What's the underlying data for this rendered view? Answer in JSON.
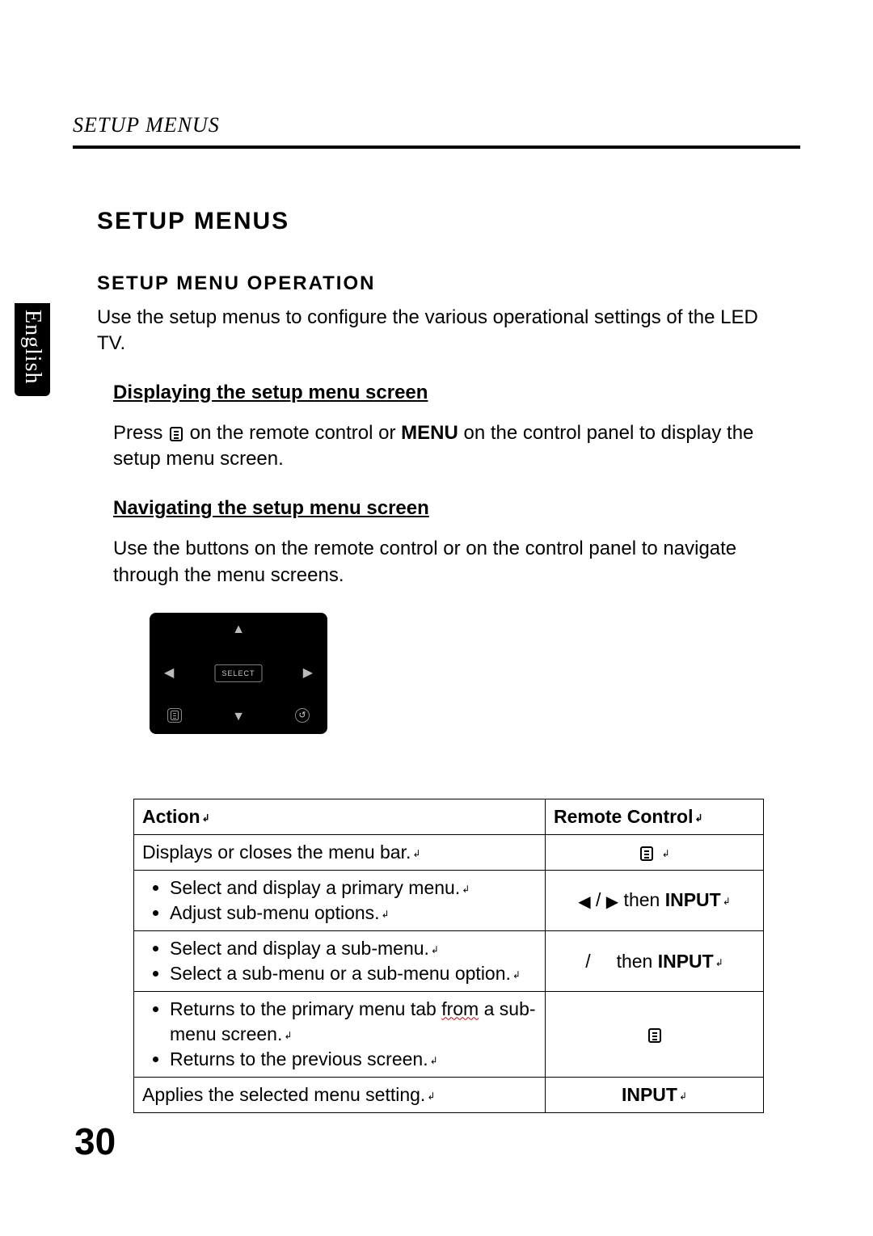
{
  "header": {
    "running": "SETUP MENUS"
  },
  "langTab": "English",
  "h1": "SETUP MENUS",
  "h2": "SETUP MENU OPERATION",
  "intro": "Use the setup menus to configure the various operational settings of the LED TV.",
  "sec1": {
    "head": "Displaying the setup menu screen",
    "p_a": "Press ",
    "p_b": " on the remote control or ",
    "menu_word": "MENU",
    "p_c": " on the control panel to display the setup menu screen."
  },
  "sec2": {
    "head": "Navigating the setup menu screen",
    "p": "Use the buttons on the remote control or on the control panel to navigate through the menu screens."
  },
  "remote": {
    "select": "SELECT",
    "back": "↺"
  },
  "table": {
    "h_action": "Action",
    "h_remote": "Remote Control",
    "r1": {
      "action": "Displays or closes the menu bar."
    },
    "r2": {
      "a": "Select and display a primary menu.",
      "b": "Adjust sub-menu options.",
      "rc_then": " then ",
      "rc_input": "INPUT"
    },
    "r3": {
      "a": "Select and display a sub-menu.",
      "b": "Select a sub-menu or a sub-menu option.",
      "rc_slash": "/",
      "rc_then": "then ",
      "rc_input": "INPUT"
    },
    "r4": {
      "a_pre": "Returns to the primary menu tab ",
      "a_wavy": "from",
      "a_post": " a sub-menu screen.",
      "b": "Returns to the previous screen."
    },
    "r5": {
      "action": "Applies the selected menu setting.",
      "rc": "INPUT"
    }
  },
  "pageNumber": "30",
  "glyphs": {
    "pm": "↲",
    "left": "◀",
    "right": "▶",
    "up": "▲",
    "down": "▼"
  }
}
